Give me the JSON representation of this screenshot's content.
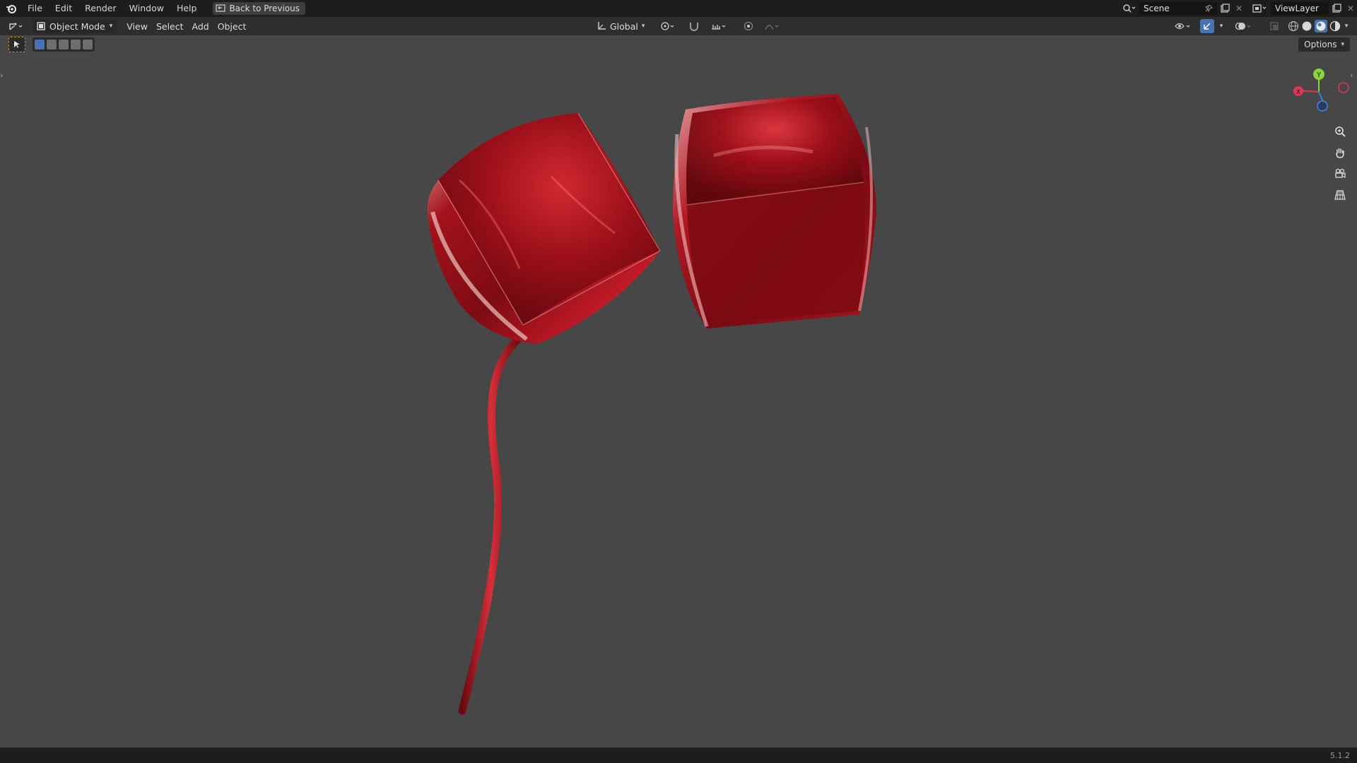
{
  "topbar": {
    "menu": [
      "File",
      "Edit",
      "Render",
      "Window",
      "Help"
    ],
    "back_label": "Back to Previous",
    "scene_name": "Scene",
    "view_layer": "ViewLayer"
  },
  "header": {
    "mode": "Object Mode",
    "menus": [
      "View",
      "Select",
      "Add",
      "Object"
    ],
    "orientation": "Global"
  },
  "viewport": {
    "options_label": "Options",
    "gizmo_axes": {
      "x": "X",
      "y": "Y"
    },
    "accent_color": "#4772b3",
    "balloon_color": "#b3141f"
  },
  "status": {
    "version": "5.1.2"
  }
}
